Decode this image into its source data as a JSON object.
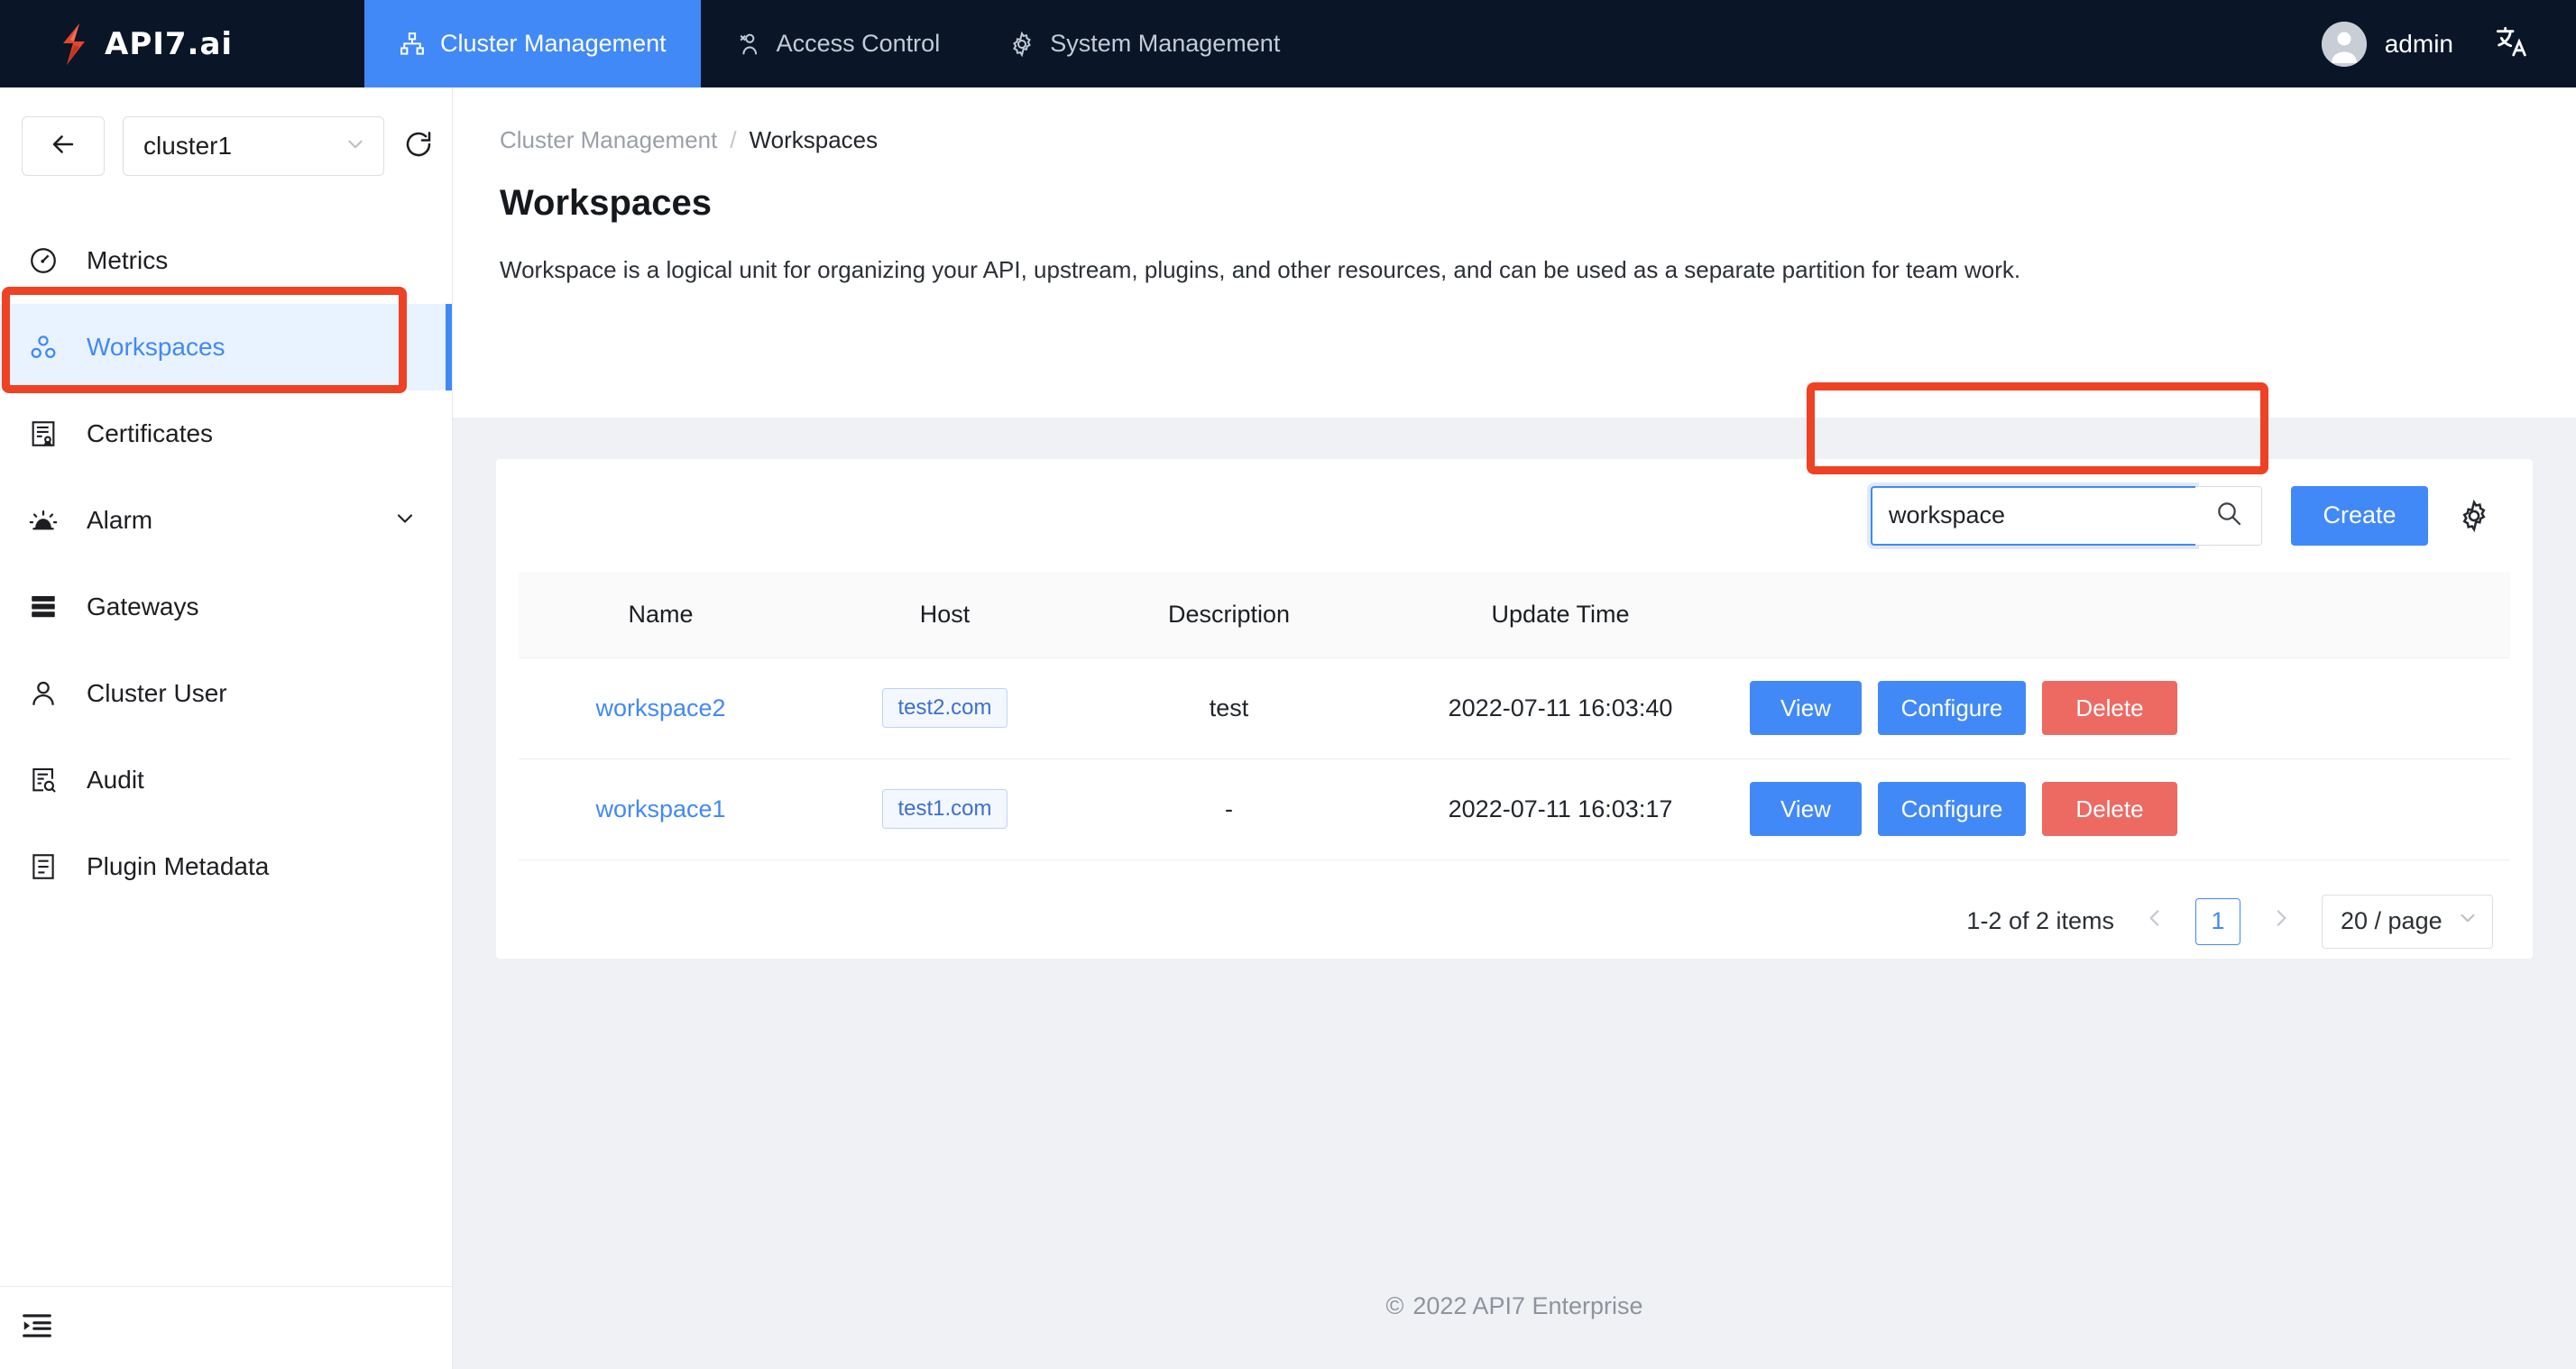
{
  "brand": {
    "name": "API7.ai",
    "logo_icon": "api7-lightning-logo"
  },
  "topnav": {
    "items": [
      {
        "label": "Cluster Management",
        "icon": "sitemap-icon",
        "active": true
      },
      {
        "label": "Access Control",
        "icon": "user-group-icon",
        "active": false
      },
      {
        "label": "System Management",
        "icon": "gear-icon",
        "active": false
      }
    ],
    "user": {
      "name": "admin",
      "avatar_icon": "user-avatar-icon"
    },
    "language_icon": "translate-icon"
  },
  "sidebar": {
    "back_icon": "arrow-left-icon",
    "cluster_selector": {
      "value": "cluster1",
      "caret_icon": "chevron-down-icon"
    },
    "refresh_icon": "refresh-icon",
    "items": [
      {
        "label": "Metrics",
        "icon": "gauge-icon",
        "active": false,
        "expandable": false
      },
      {
        "label": "Workspaces",
        "icon": "workspaces-icon",
        "active": true,
        "expandable": false
      },
      {
        "label": "Certificates",
        "icon": "certificate-icon",
        "active": false,
        "expandable": false
      },
      {
        "label": "Alarm",
        "icon": "alarm-bell-icon",
        "active": false,
        "expandable": true
      },
      {
        "label": "Gateways",
        "icon": "server-rack-icon",
        "active": false,
        "expandable": false
      },
      {
        "label": "Cluster User",
        "icon": "user-icon",
        "active": false,
        "expandable": false
      },
      {
        "label": "Audit",
        "icon": "audit-search-icon",
        "active": false,
        "expandable": false
      },
      {
        "label": "Plugin Metadata",
        "icon": "plugin-list-icon",
        "active": false,
        "expandable": false
      }
    ],
    "collapse_icon": "menu-collapse-icon"
  },
  "breadcrumb": {
    "parent": "Cluster Management",
    "separator": "/",
    "current": "Workspaces"
  },
  "page": {
    "title": "Workspaces",
    "description": "Workspace is a logical unit for organizing your API, upstream, plugins, and other resources, and can be used as a separate partition for team work."
  },
  "toolbar": {
    "search_value": "workspace",
    "search_placeholder": "",
    "search_icon": "search-icon",
    "create_label": "Create",
    "settings_icon": "gear-icon"
  },
  "table": {
    "columns": [
      "Name",
      "Host",
      "Description",
      "Update Time",
      ""
    ],
    "rows": [
      {
        "name": "workspace2",
        "host": "test2.com",
        "description": "test",
        "update_time": "2022-07-11 16:03:40",
        "actions": [
          "View",
          "Configure",
          "Delete"
        ]
      },
      {
        "name": "workspace1",
        "host": "test1.com",
        "description": "-",
        "update_time": "2022-07-11 16:03:17",
        "actions": [
          "View",
          "Configure",
          "Delete"
        ]
      }
    ]
  },
  "pagination": {
    "summary": "1-2 of 2 items",
    "prev_icon": "chevron-left-icon",
    "next_icon": "chevron-right-icon",
    "current_page": "1",
    "page_size": "20 / page",
    "page_size_caret": "chevron-down-icon"
  },
  "footer": {
    "copyright_symbol": "©",
    "text": "2022 API7 Enterprise"
  },
  "annotations": {
    "highlight_color": "#ef4123"
  }
}
